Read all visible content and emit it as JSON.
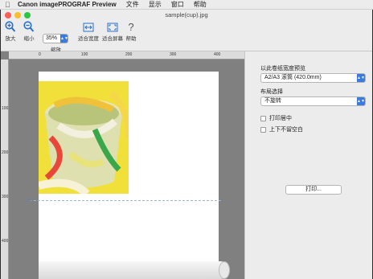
{
  "menubar": {
    "app_name": "Canon imagePROGRAF Preview",
    "items": [
      "文件",
      "显示",
      "窗口",
      "帮助"
    ]
  },
  "window": {
    "title": "sample(cup).jpg"
  },
  "toolbar": {
    "zoom_in": "放大",
    "zoom_out": "缩小",
    "zoom_label": "缩放",
    "zoom_value": "35%",
    "fit_width": "适合宽度",
    "fit_screen": "适合屏幕",
    "help": "帮助"
  },
  "rulers": {
    "h_ticks": [
      "0",
      "100",
      "200",
      "300",
      "400"
    ],
    "v_ticks": [
      "100",
      "200",
      "300",
      "400"
    ]
  },
  "side": {
    "preview_label": "以此卷纸宽度预览",
    "preview_value": "A2/A3 滚筒 (420.0mm)",
    "layout_label": "布局选择",
    "layout_value": "不旋转",
    "center_label": "打印居中",
    "nomargin_label": "上下不留空白",
    "print_button": "打印..."
  },
  "colors": {
    "accent": "#3b7be0",
    "canvas": "#808080",
    "close": "#fc5f57",
    "minimize": "#fdbc2e",
    "zoom": "#28c840"
  }
}
